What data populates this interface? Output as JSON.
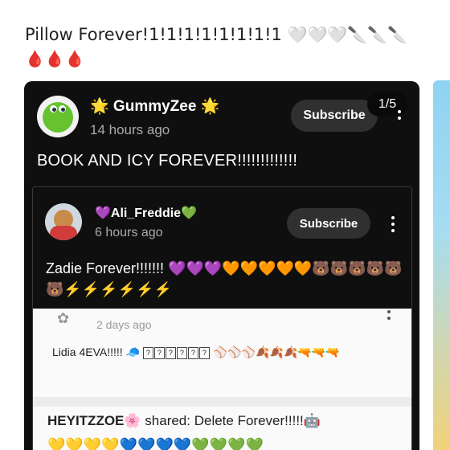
{
  "post": {
    "text": "Pillow Forever!1!1!1!1!1!1!1!1",
    "emojis_line1": "🤍🤍🤍🔪🔪🔪",
    "emojis_line2": "🩸🩸🩸"
  },
  "card": {
    "pager": "1/5",
    "channel": "🌟 GummyZee 🌟",
    "time": "14 hours ago",
    "subscribe_label": "Subscribe",
    "text": "BOOK AND ICY FOREVER!!!!!!!!!!!!!",
    "inner": {
      "channel": "💜Ali_Freddie💚",
      "time": "6 hours ago",
      "subscribe_label": "Subscribe",
      "text": "Zadie Forever!!!!!!! 💜💜💜🧡🧡🧡🧡🧡🐻🐻🐻🐻🐻🐻⚡⚡⚡⚡⚡⚡"
    },
    "quoted": {
      "time": "2 days ago",
      "text_prefix": "Lidia 4EVA!!!!! 🧢",
      "box_glyph": "?",
      "text_suffix": "⚾⚾⚾🍂🍂🍂🔫🔫🔫"
    },
    "shared": {
      "author": "HEYITZZOE🌸",
      "rest": " shared: Delete Forever!!!!!🤖",
      "emojis": "💛💛💛💛💙💙💙💙💚💚💚💚"
    }
  }
}
